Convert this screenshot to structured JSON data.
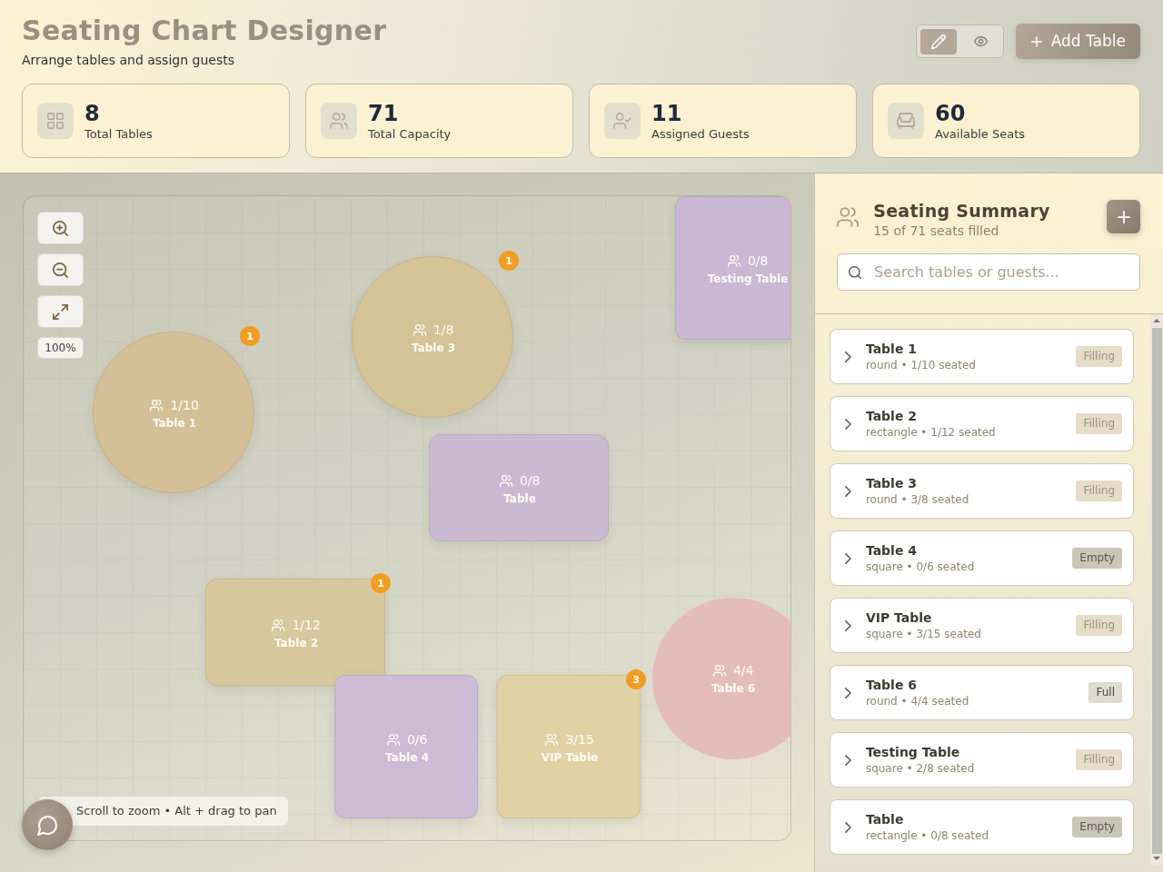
{
  "header": {
    "title": "Seating Chart Designer",
    "subtitle": "Arrange tables and assign guests",
    "mode_toggle": [
      {
        "kind": "edit",
        "selected": true
      },
      {
        "kind": "view",
        "selected": false
      }
    ],
    "add_button": "Add Table"
  },
  "stats": [
    {
      "kind": "tables",
      "value": "8",
      "label": "Total Tables"
    },
    {
      "kind": "capacity",
      "value": "71",
      "label": "Total Capacity"
    },
    {
      "kind": "assigned",
      "value": "11",
      "label": "Assigned Guests"
    },
    {
      "kind": "available",
      "value": "60",
      "label": "Available Seats"
    }
  ],
  "canvas": {
    "zoom_level": "100%",
    "tables": [
      {
        "name": "Table 1",
        "kind": "round",
        "seated": "1/10",
        "badge": "1",
        "color": "#d3c096"
      },
      {
        "name": "Table 3",
        "kind": "round",
        "seated": "1/8",
        "badge": "1",
        "color": "#d5c398"
      },
      {
        "name": "Testing Table",
        "kind": "square",
        "seated": "0/8",
        "color": "#c9b7d3"
      },
      {
        "name": "Table",
        "kind": "rectangle",
        "seated": "0/8",
        "color": "#cbb9d3"
      },
      {
        "name": "Table 2",
        "kind": "rectangle",
        "seated": "1/12",
        "badge": "1",
        "color": "#d9c89d"
      },
      {
        "name": "Table 4",
        "kind": "square",
        "seated": "0/6",
        "color": "#cdbad4"
      },
      {
        "name": "VIP Table",
        "kind": "square",
        "seated": "3/15",
        "badge": "3",
        "color": "#e3d1a6"
      },
      {
        "name": "Table 6",
        "kind": "round",
        "seated": "4/4",
        "color": "#e5bdb8"
      }
    ],
    "hint": "Scroll to zoom • Alt + drag to pan"
  },
  "summary": {
    "title": "Seating Summary",
    "subtitle": "15 of 71 seats filled",
    "search": {
      "placeholder": "Search tables or guests..."
    },
    "tables": [
      {
        "name": "Table 1",
        "detail": "round • 1/10 seated",
        "status": "Filling",
        "kind": "filling"
      },
      {
        "name": "Table 2",
        "detail": "rectangle • 1/12 seated",
        "status": "Filling",
        "kind": "filling"
      },
      {
        "name": "Table 3",
        "detail": "round • 3/8 seated",
        "status": "Filling",
        "kind": "filling"
      },
      {
        "name": "Table 4",
        "detail": "square • 0/6 seated",
        "status": "Empty",
        "kind": "empty"
      },
      {
        "name": "VIP Table",
        "detail": "square • 3/15 seated",
        "status": "Filling",
        "kind": "filling"
      },
      {
        "name": "Table 6",
        "detail": "round • 4/4 seated",
        "status": "Full",
        "kind": "full"
      },
      {
        "name": "Testing Table",
        "detail": "square • 2/8 seated",
        "status": "Filling",
        "kind": "filling"
      },
      {
        "name": "Table",
        "detail": "rectangle • 0/8 seated",
        "status": "Empty",
        "kind": "empty"
      }
    ]
  }
}
